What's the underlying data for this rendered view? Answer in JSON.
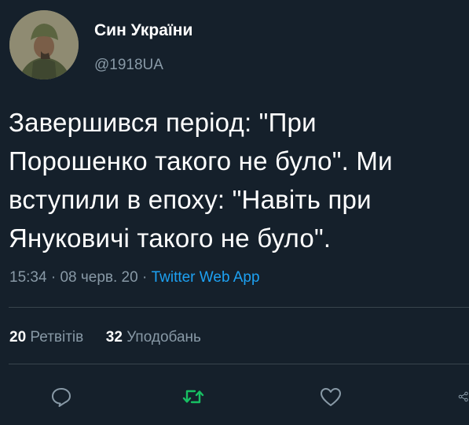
{
  "user": {
    "display_name": "Син України",
    "handle": "@1918UA"
  },
  "tweet": {
    "lines": [
      "Завершився період: \"При",
      "Порошенко такого не було\". Ми",
      "вступили в епоху: \"Навіть при",
      "Януковичі такого не було\"."
    ],
    "time": "15:34",
    "separator": "·",
    "date": "08 черв. 20",
    "source": "Twitter Web App"
  },
  "stats": {
    "retweets_count": "20",
    "retweets_label": "Ретвітів",
    "likes_count": "32",
    "likes_label": "Уподобань"
  },
  "actions": [
    {
      "icon": "reply-icon"
    },
    {
      "icon": "retweet-icon"
    },
    {
      "icon": "like-icon"
    },
    {
      "icon": "share-icon"
    }
  ],
  "colors": {
    "background": "#15202b",
    "text": "#ffffff",
    "secondary": "#8899a6",
    "link": "#1da1f2",
    "retweet_accent": "#17bf63",
    "divider": "#38444d"
  }
}
